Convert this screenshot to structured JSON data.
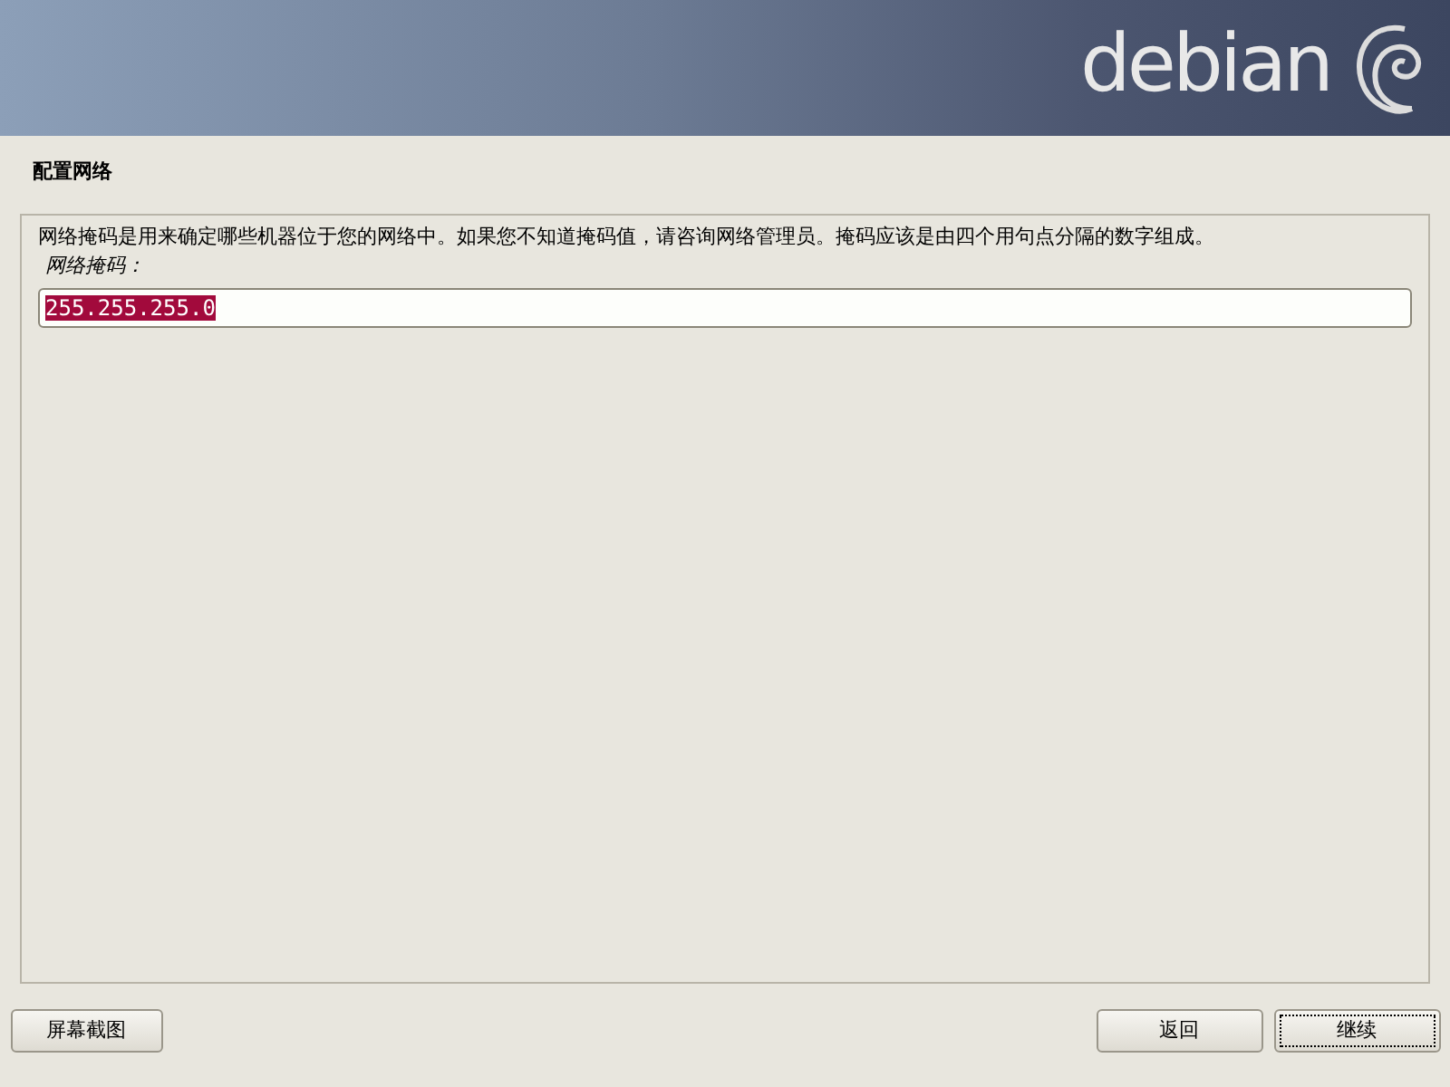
{
  "banner": {
    "logo_text": "debian"
  },
  "title": "配置网络",
  "description": "网络掩码是用来确定哪些机器位于您的网络中。如果您不知道掩码值，请咨询网络管理员。掩码应该是由四个用句点分隔的数字组成。",
  "field": {
    "label": "网络掩码：",
    "value": "255.255.255.0",
    "value_selected": true
  },
  "left_buttons": [
    {
      "label": "屏幕截图",
      "focused": false
    }
  ],
  "right_buttons": [
    {
      "label": "返回",
      "focused": false
    },
    {
      "label": "继续",
      "focused": true
    }
  ]
}
